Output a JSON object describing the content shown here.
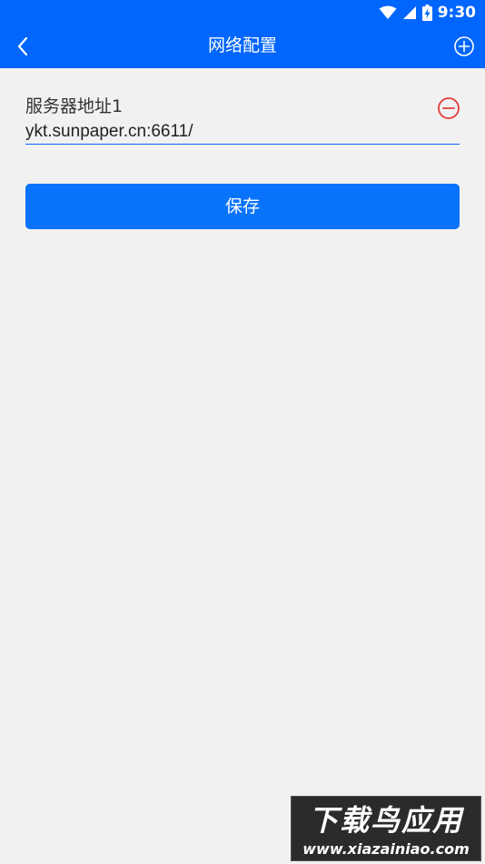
{
  "status_bar": {
    "time": "9:30",
    "icons": [
      "wifi-icon",
      "cellular-signal-icon",
      "battery-charging-icon"
    ]
  },
  "app_bar": {
    "title": "网络配置",
    "back_icon": "chevron-left-icon",
    "add_icon": "plus-circle-icon"
  },
  "servers": [
    {
      "label": "服务器地址1",
      "value": "ykt.sunpaper.cn:6611/",
      "remove_icon": "minus-circle-icon"
    }
  ],
  "save_label": "保存",
  "watermark": {
    "title": "下载鸟应用",
    "url": "www.xiazainiao.com"
  },
  "colors": {
    "primary": "#0066fd",
    "button": "#0a73fb",
    "background": "#f1f1f1",
    "remove": "#e53935",
    "label_text": "#333333"
  }
}
